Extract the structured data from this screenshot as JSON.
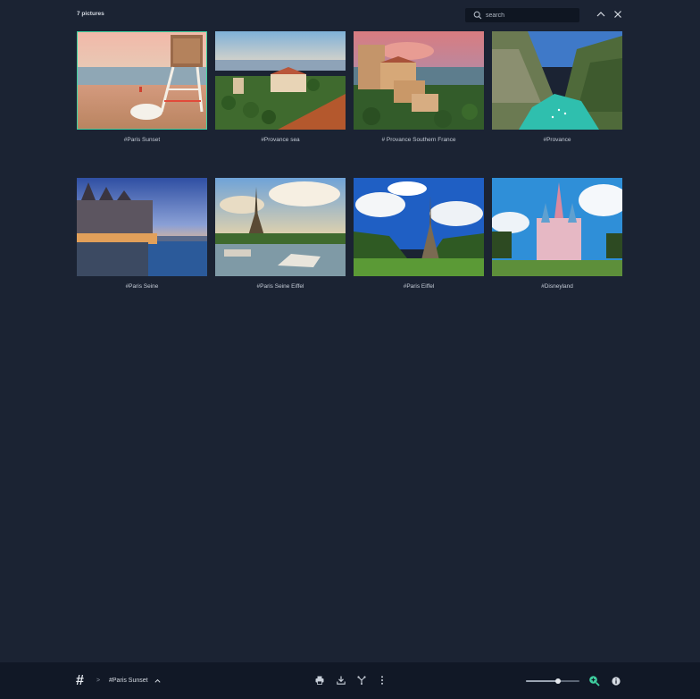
{
  "header": {
    "count_label": "7 pictures",
    "search_placeholder": "search"
  },
  "gallery": {
    "tiles": [
      {
        "caption": "#Paris Sunset",
        "selected": true
      },
      {
        "caption": "#Provance sea",
        "selected": false
      },
      {
        "caption": "# Provance Southern France",
        "selected": false
      },
      {
        "caption": "#Provance",
        "selected": false
      },
      {
        "caption": "#Paris Seine",
        "selected": false
      },
      {
        "caption": "#Paris Seine Eiffel",
        "selected": false
      },
      {
        "caption": "#Paris Eiffel",
        "selected": false
      },
      {
        "caption": "#Disneyland",
        "selected": false
      }
    ]
  },
  "footer": {
    "logo": "#",
    "breadcrumb_separator": ">",
    "current_item": "#Paris Sunset",
    "tools": [
      "print-icon",
      "download-icon",
      "share-icon",
      "more-vertical-icon"
    ],
    "zoom_level_fraction": 0.6
  },
  "colors": {
    "background": "#1b2333",
    "footer_background": "#111826",
    "accent": "#3fd0a0"
  }
}
